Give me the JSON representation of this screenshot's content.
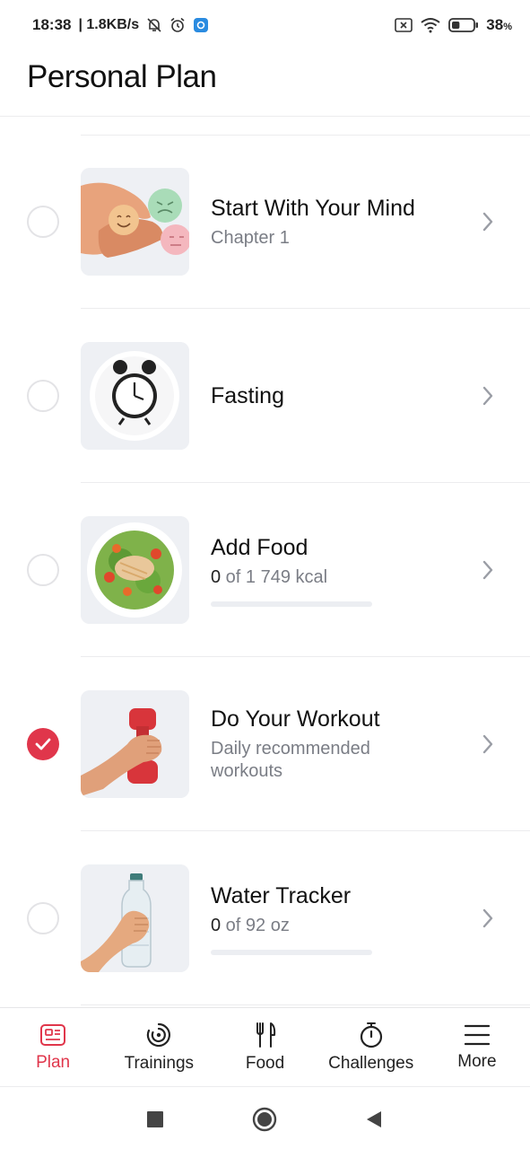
{
  "status_bar": {
    "time": "18:38",
    "speed": "| 1.8KB/s",
    "battery": "38",
    "battery_unit": "%",
    "battery_level": 0.38
  },
  "header": {
    "title": "Personal Plan"
  },
  "plan_items": [
    {
      "title": "Start With Your Mind",
      "subtitle": "Chapter 1",
      "completed": false,
      "icon": "mind-emotions-image"
    },
    {
      "title": "Fasting",
      "completed": false,
      "icon": "alarm-clock-plate-image"
    },
    {
      "title": "Add Food",
      "sub_value": "0",
      "sub_rest": " of 1 749 kcal",
      "progress": 0,
      "completed": false,
      "icon": "salad-plate-image"
    },
    {
      "title": "Do Your Workout",
      "subtitle_line1": "Daily recommended",
      "subtitle_line2": "workouts",
      "completed": true,
      "icon": "dumbbell-hand-image"
    },
    {
      "title": "Water Tracker",
      "sub_value": "0",
      "sub_rest": " of 92 oz",
      "progress": 0,
      "completed": false,
      "icon": "water-bottle-hand-image"
    }
  ],
  "bottom_nav": [
    {
      "label": "Plan",
      "icon": "plan-icon",
      "active": true
    },
    {
      "label": "Trainings",
      "icon": "trainings-icon",
      "active": false
    },
    {
      "label": "Food",
      "icon": "fork-knife-icon",
      "active": false
    },
    {
      "label": "Challenges",
      "icon": "stopwatch-icon",
      "active": false
    },
    {
      "label": "More",
      "icon": "menu-icon",
      "active": false
    }
  ],
  "colors": {
    "accent": "#e0364b",
    "thumb_bg": "#eef0f4",
    "muted_text": "#7a7d85"
  }
}
